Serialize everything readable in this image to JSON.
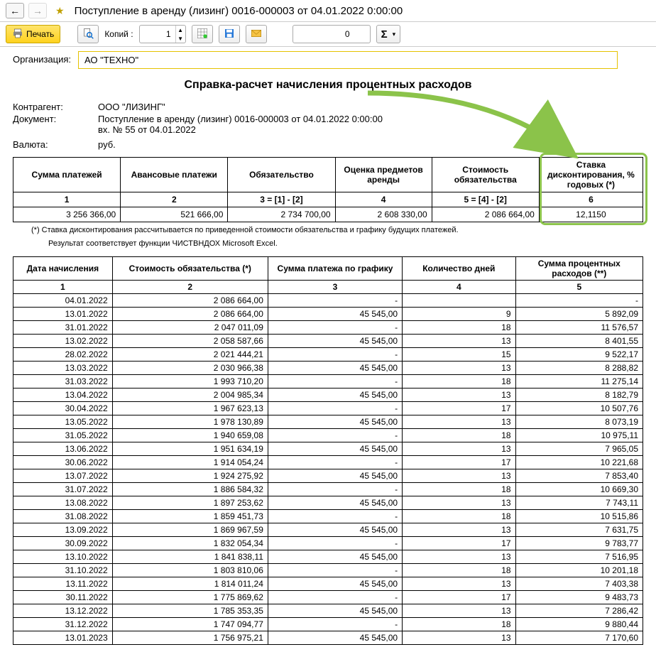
{
  "window": {
    "title": "Поступление в аренду (лизинг) 0016-000003 от 04.01.2022 0:00:00"
  },
  "toolbar": {
    "print": "Печать",
    "copies_label": "Копий :",
    "copies_value": "1",
    "sum_value": "0"
  },
  "org": {
    "label": "Организация:",
    "value": "АО \"ТЕХНО\""
  },
  "report": {
    "title": "Справка-расчет начисления процентных расходов",
    "meta": {
      "counterparty_label": "Контрагент:",
      "counterparty_value": "ООО \"ЛИЗИНГ\"",
      "doc_label": "Документ:",
      "doc_line1": "Поступление в аренду (лизинг) 0016-000003 от 04.01.2022 0:00:00",
      "doc_line2": "вх. № 55 от 04.01.2022",
      "currency_label": "Валюта:",
      "currency_value": "руб."
    },
    "t1": {
      "headers": [
        "Сумма платежей",
        "Авансовые платежи",
        "Обязательство",
        "Оценка предметов аренды",
        "Стоимость обязательства",
        "Ставка дисконтирования, % годовых (*)"
      ],
      "sub": [
        "1",
        "2",
        "3 = [1] - [2]",
        "4",
        "5 = [4] - [2]",
        "6"
      ],
      "row": [
        "3 256 366,00",
        "521 666,00",
        "2 734 700,00",
        "2 608 330,00",
        "2 086 664,00",
        "12,1150"
      ]
    },
    "footnote": {
      "line1": "(*)  Ставка дисконтирования рассчитывается по приведенной стоимости обязательства и графику будущих платежей.",
      "line2": "Результат соответствует функции ЧИСТВНДОХ Microsoft Excel."
    },
    "t2": {
      "headers": [
        "Дата начисления",
        "Стоимость обязательства (*)",
        "Сумма платежа по графику",
        "Количество дней",
        "Сумма процентных расходов (**)"
      ],
      "sub": [
        "1",
        "2",
        "3",
        "4",
        "5"
      ],
      "rows": [
        [
          "04.01.2022",
          "2 086 664,00",
          "-",
          "",
          "-"
        ],
        [
          "13.01.2022",
          "2 086 664,00",
          "45 545,00",
          "9",
          "5 892,09"
        ],
        [
          "31.01.2022",
          "2 047 011,09",
          "-",
          "18",
          "11 576,57"
        ],
        [
          "13.02.2022",
          "2 058 587,66",
          "45 545,00",
          "13",
          "8 401,55"
        ],
        [
          "28.02.2022",
          "2 021 444,21",
          "-",
          "15",
          "9 522,17"
        ],
        [
          "13.03.2022",
          "2 030 966,38",
          "45 545,00",
          "13",
          "8 288,82"
        ],
        [
          "31.03.2022",
          "1 993 710,20",
          "-",
          "18",
          "11 275,14"
        ],
        [
          "13.04.2022",
          "2 004 985,34",
          "45 545,00",
          "13",
          "8 182,79"
        ],
        [
          "30.04.2022",
          "1 967 623,13",
          "-",
          "17",
          "10 507,76"
        ],
        [
          "13.05.2022",
          "1 978 130,89",
          "45 545,00",
          "13",
          "8 073,19"
        ],
        [
          "31.05.2022",
          "1 940 659,08",
          "-",
          "18",
          "10 975,11"
        ],
        [
          "13.06.2022",
          "1 951 634,19",
          "45 545,00",
          "13",
          "7 965,05"
        ],
        [
          "30.06.2022",
          "1 914 054,24",
          "-",
          "17",
          "10 221,68"
        ],
        [
          "13.07.2022",
          "1 924 275,92",
          "45 545,00",
          "13",
          "7 853,40"
        ],
        [
          "31.07.2022",
          "1 886 584,32",
          "-",
          "18",
          "10 669,30"
        ],
        [
          "13.08.2022",
          "1 897 253,62",
          "45 545,00",
          "13",
          "7 743,11"
        ],
        [
          "31.08.2022",
          "1 859 451,73",
          "-",
          "18",
          "10 515,86"
        ],
        [
          "13.09.2022",
          "1 869 967,59",
          "45 545,00",
          "13",
          "7 631,75"
        ],
        [
          "30.09.2022",
          "1 832 054,34",
          "-",
          "17",
          "9 783,77"
        ],
        [
          "13.10.2022",
          "1 841 838,11",
          "45 545,00",
          "13",
          "7 516,95"
        ],
        [
          "31.10.2022",
          "1 803 810,06",
          "-",
          "18",
          "10 201,18"
        ],
        [
          "13.11.2022",
          "1 814 011,24",
          "45 545,00",
          "13",
          "7 403,38"
        ],
        [
          "30.11.2022",
          "1 775 869,62",
          "-",
          "17",
          "9 483,73"
        ],
        [
          "13.12.2022",
          "1 785 353,35",
          "45 545,00",
          "13",
          "7 286,42"
        ],
        [
          "31.12.2022",
          "1 747 094,77",
          "-",
          "18",
          "9 880,44"
        ],
        [
          "13.01.2023",
          "1 756 975,21",
          "45 545,00",
          "13",
          "7 170,60"
        ]
      ]
    }
  }
}
